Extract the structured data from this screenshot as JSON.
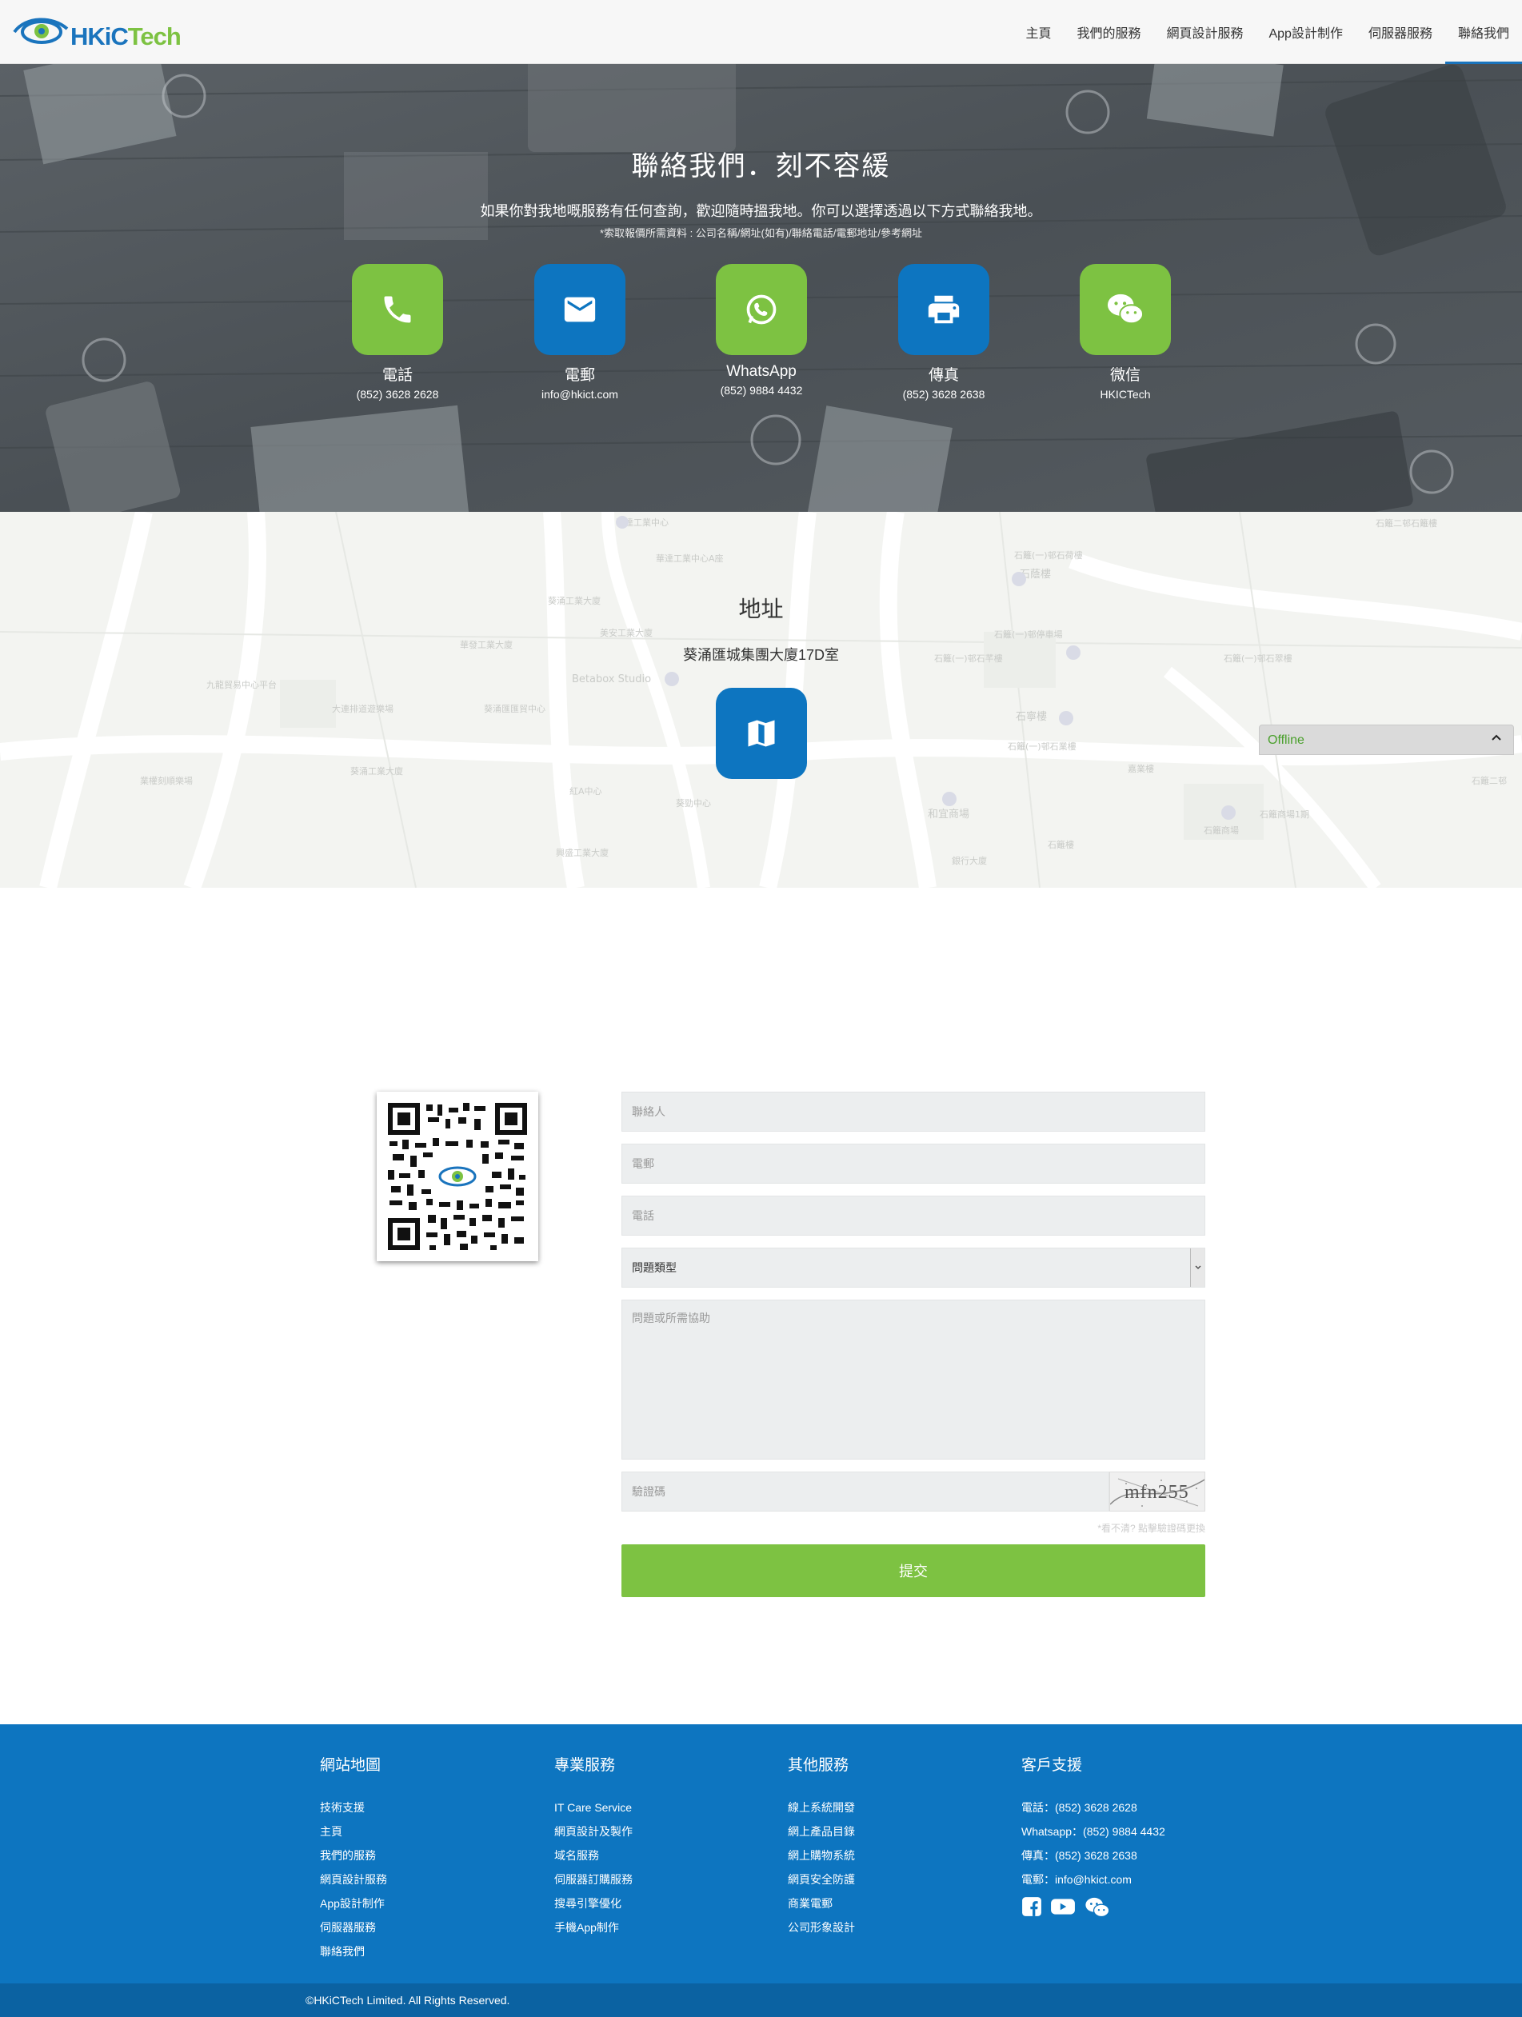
{
  "header": {
    "brand_hk": "HKiC",
    "brand_tech": "Tech",
    "nav": [
      "主頁",
      "我們的服務",
      "網頁設計服務",
      "App設計制作",
      "伺服器服務",
      "聯絡我們"
    ],
    "active_nav": "聯絡我們"
  },
  "hero": {
    "title": "聯絡我們．刻不容緩",
    "subtitle": "如果你對我地嘅服務有任何查詢，歡迎隨時搵我地。你可以選擇透過以下方式聯絡我地。",
    "note": "*索取報價所需資料 : 公司名稱/網址(如有)/聯絡電話/電郵地址/參考網址",
    "contacts": [
      {
        "label": "電話",
        "value": "(852) 3628 2628",
        "icon": "phone-icon",
        "color": "#7dc242"
      },
      {
        "label": "電郵",
        "value": "info@hkict.com",
        "icon": "mail-icon",
        "color": "#0d75c0"
      },
      {
        "label": "WhatsApp",
        "value": "(852) 9884 4432",
        "icon": "whatsapp-icon",
        "color": "#7dc242"
      },
      {
        "label": "傳真",
        "value": "(852) 3628 2638",
        "icon": "printer-icon",
        "color": "#0d75c0"
      },
      {
        "label": "微信",
        "value": "HKICTech",
        "icon": "wechat-icon",
        "color": "#7dc242"
      }
    ]
  },
  "map": {
    "title": "地址",
    "address": "葵涌匯城集團大廈17D室",
    "button_icon": "map-icon",
    "labels": [
      "華達工業中心",
      "華達工業中心A座",
      "葵涌工業大廈",
      "美安工業大廈",
      "華發工業大廈",
      "九龍貿易中心平台",
      "大連排道遊樂場",
      "葵涌匯匯貿中心",
      "Betabox Studio",
      "葵涌工業大廈",
      "業權刻順樂場",
      "紅A中心",
      "葵勁中心",
      "興盛工業大廈",
      "石籬(一)邨石荷樓",
      "石籬(一)邨停車場",
      "石籬(一)邨石芊樓",
      "石寧樓",
      "石籬(一)邨石業樓",
      "和宜商場",
      "石籬二邨石籬樓",
      "石蔭樓",
      "石籬商場",
      "石籬二邨",
      "銀行大廈",
      "石籬(一)邨石翠樓",
      "嘉業樓",
      "石籬樓",
      "石籬商場1期"
    ]
  },
  "chat": {
    "status": "Offline",
    "chevron": "^"
  },
  "form": {
    "contact_person_placeholder": "聯絡人",
    "email_placeholder": "電郵",
    "phone_placeholder": "電話",
    "topic_selected": "問題類型",
    "message_placeholder": "問題或所需協助",
    "captcha_placeholder": "驗證碼",
    "captcha_text": "mfn255",
    "refresh_note": "*看不清? 點擊驗證碼更換",
    "submit_label": "提交"
  },
  "footer": {
    "col1": {
      "title": "網站地圖",
      "links": [
        "技術支援",
        "主頁",
        "我們的服務",
        "網頁設計服務",
        "App設計制作",
        "伺服器服務",
        "聯絡我們"
      ]
    },
    "col2": {
      "title": "專業服務",
      "links": [
        "IT Care Service",
        "網頁設計及製作",
        "域名服務",
        "伺服器訂購服務",
        "搜尋引擎優化",
        "手機App制作"
      ]
    },
    "col3": {
      "title": "其他服務",
      "links": [
        "線上系統開發",
        "網上產品目錄",
        "網上購物系統",
        "網頁安全防護",
        "商業電郵",
        "公司形象設計"
      ]
    },
    "col4": {
      "title": "客戶支援",
      "info": [
        "電話：(852) 3628 2628",
        "Whatsapp：(852) 9884 4432",
        "傳真：(852) 3628 2638",
        "電郵：info@hkict.com"
      ],
      "socials": [
        "facebook-icon",
        "youtube-icon",
        "wechat-icon"
      ]
    },
    "copyright": "©HKiCTech Limited. All Rights Reserved."
  },
  "colors": {
    "blue": "#0d75c0",
    "green": "#7dc242",
    "dark_blue": "#0b62a2"
  }
}
